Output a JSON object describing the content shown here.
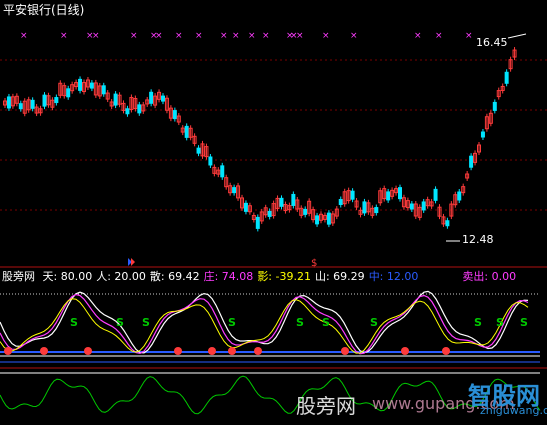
{
  "window": {
    "title": "平安银行(日线)"
  },
  "main_chart": {
    "high_label": "16.45",
    "low_label": "12.48"
  },
  "indicator": {
    "name": "股旁网",
    "fields": [
      {
        "label": "天",
        "value": "80.00",
        "color": "#ffffff"
      },
      {
        "label": "人",
        "value": "20.00",
        "color": "#ffffff"
      },
      {
        "label": "散",
        "value": "69.42",
        "color": "#ffffff"
      },
      {
        "label": "庄",
        "value": "74.08",
        "color": "#ff3cff"
      },
      {
        "label": "影",
        "value": "-39.21",
        "color": "#ffff00"
      },
      {
        "label": "山",
        "value": "69.29",
        "color": "#ffffff"
      },
      {
        "label": "中",
        "value": "12.00",
        "color": "#2a5bff"
      },
      {
        "label": "卖出",
        "value": "0.00",
        "color": "#ff3cff"
      }
    ]
  },
  "watermark": {
    "text": "股旁网",
    "site": "www.gupang.com",
    "brand": "智股网",
    "url": "zhiguwang.com"
  },
  "colors": {
    "up": "#ff3b3b",
    "down": "#00e5ff",
    "magenta": "#ff3cff",
    "green": "#00c800",
    "blue": "#2a5bff"
  }
}
